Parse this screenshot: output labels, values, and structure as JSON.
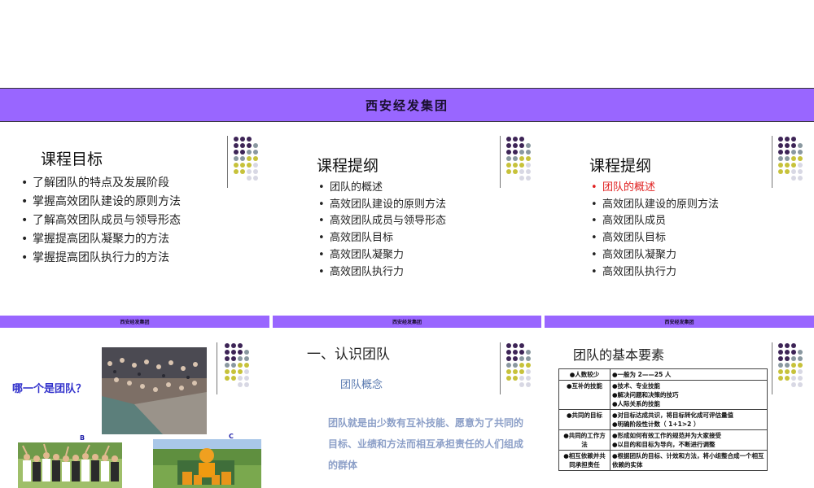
{
  "banner": {
    "title": "西安经发集团"
  },
  "footer_text": "西安经发集团",
  "slide1": {
    "title": "课程目标",
    "items": [
      "了解团队的特点及发展阶段",
      "掌握高效团队建设的原则方法",
      "了解高效团队成员与领导形态",
      "掌握提高团队凝聚力的方法",
      "掌握提高团队执行力的方法"
    ]
  },
  "slide2": {
    "title": "课程提纲",
    "items": [
      "团队的概述",
      "高效团队建设的原则方法",
      "高效团队成员与领导形态",
      "高效团队目标",
      "高效团队凝聚力",
      "高效团队执行力"
    ]
  },
  "slide3": {
    "title": "课程提纲",
    "items": [
      "团队的概述",
      "高效团队建设的原则方法",
      "高效团队成员",
      "高效团队目标",
      "高效团队凝聚力",
      "高效团队执行力"
    ],
    "highlight_color": "#e02020"
  },
  "slide4": {
    "question": "哪一个是团队？",
    "label_b": "B",
    "label_c": "C"
  },
  "slide5": {
    "section": "一、认识团队",
    "subtitle": "团队概念",
    "definition": "团队就是由少数有互补技能、愿意为了共同的目标、业绩和方法而相互承担责任的人们组成的群体"
  },
  "slide6": {
    "title": "团队的基本要素",
    "rows": [
      {
        "element": "●人数较少",
        "details": [
          "●一般为 2——25 人"
        ]
      },
      {
        "element": "●互补的技能",
        "details": [
          "●技术、专业技能",
          "●解决问题和决策的技巧",
          "●人际关系的技能"
        ]
      },
      {
        "element": "●共同的目标",
        "details": [
          "●对目标达成共识，将目标转化成可评估量值",
          "●明确阶段性计数（ 1+1>2 ）"
        ]
      },
      {
        "element": "●共同的工作方法",
        "details": [
          "●形成如何有效工作的规范并为大家接受",
          "●以目的和目标为导向，不断进行调整"
        ]
      },
      {
        "element": "●相互依赖并共同承担责任",
        "details": [
          "●根据团队的目标、计效和方法，将小组整合成一个相互依赖的实体"
        ]
      }
    ]
  },
  "colors": {
    "banner": "#9966ff",
    "dot_purple": "#3d2456",
    "dot_gray": "#8a98a0",
    "dot_yellow": "#c7c23a",
    "dot_light": "#d8d8e4"
  }
}
